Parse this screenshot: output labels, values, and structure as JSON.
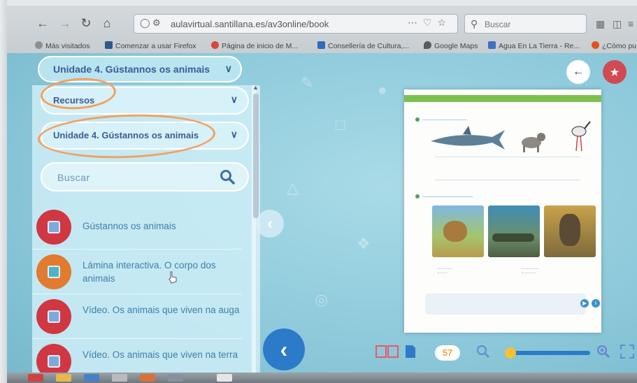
{
  "browser": {
    "url": "aulavirtual.santillana.es/av3online/book",
    "search_placeholder": "Buscar",
    "bookmarks": [
      {
        "label": "Más visitados",
        "color": "#8f8f8f"
      },
      {
        "label": "Comenzar a usar Firefox",
        "color": "#2b5a8a"
      },
      {
        "label": "Página de inicio de M...",
        "color": "#d9473b"
      },
      {
        "label": "Consellería de Cultura,...",
        "color": "#2d6cc0"
      },
      {
        "label": "Google Maps",
        "color": "#5a5a5a"
      },
      {
        "label": "Agua En La Tierra - Re...",
        "color": "#3f6fc0"
      },
      {
        "label": "¿Cómo pu",
        "color": "#e0531f"
      }
    ]
  },
  "header": {
    "unit_selector": "Unidade 4. Gústannos os animais"
  },
  "panel": {
    "resources_dropdown": "Recursos",
    "unit_dropdown": "Unidade 4. Gústannos os animais",
    "search_placeholder": "Buscar",
    "items": [
      {
        "label": "Gústannos os animais",
        "color": "#d03743"
      },
      {
        "label": "Lámina interactiva. O corpo dos animais",
        "color": "#e07b2f"
      },
      {
        "label": "Vídeo. Os animais que viven na auga",
        "color": "#d03743"
      },
      {
        "label": "Vídeo. Os animais que viven na terra",
        "color": "#d03743"
      }
    ]
  },
  "book": {
    "page_number": "57"
  },
  "colors": {
    "panel_text": "#3d5b93",
    "accent_orange": "#f2a15e",
    "nav_blue": "#2c7bc9",
    "page_badge": "#f0a340"
  }
}
